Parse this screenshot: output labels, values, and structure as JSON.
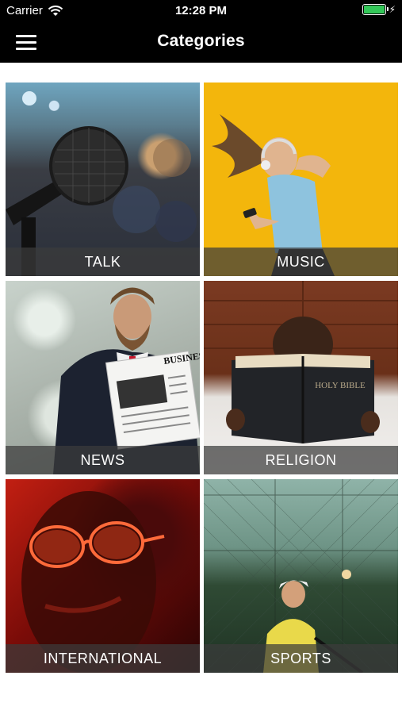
{
  "status_bar": {
    "carrier": "Carrier",
    "time": "12:28 PM",
    "battery_level": 1.0,
    "battery_color": "#34c759"
  },
  "nav_bar": {
    "title": "Categories",
    "menu_icon": "hamburger-menu-icon"
  },
  "categories": [
    {
      "label": "TALK"
    },
    {
      "label": "MUSIC"
    },
    {
      "label": "NEWS"
    },
    {
      "label": "RELIGION"
    },
    {
      "label": "INTERNATIONAL"
    },
    {
      "label": "SPORTS"
    }
  ],
  "images": {
    "religion_book_text": "HOLY BIBLE",
    "news_paper_text": "BUSINES"
  }
}
